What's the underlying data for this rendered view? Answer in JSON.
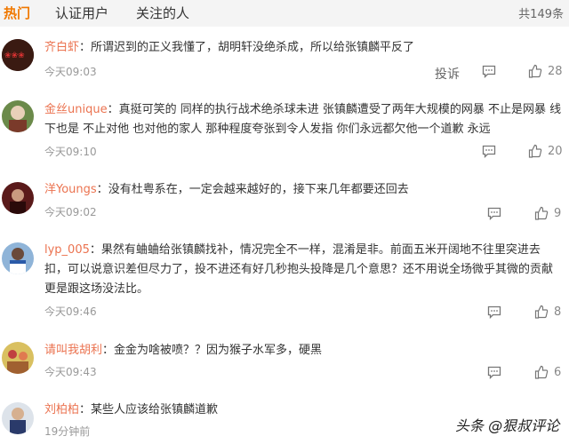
{
  "tabs": [
    {
      "label": "热门"
    },
    {
      "label": "认证用户"
    },
    {
      "label": "关注的人"
    }
  ],
  "total": "共149条",
  "report_label": "投诉",
  "comments": [
    {
      "user": "齐白虾",
      "sep": "：",
      "text": "所谓迟到的正义我懂了，胡明轩没绝杀成，所以给张镇麟平反了",
      "time": "今天09:03",
      "likes": "28"
    },
    {
      "user": "金丝unique",
      "sep": "：",
      "text": "真挺可笑的 同样的执行战术绝杀球未进 张镇麟遭受了两年大规模的网暴 不止是网暴 线下也是 不止对他 也对他的家人 那种程度夸张到令人发指 你们永远都欠他一个道歉 永远",
      "time": "今天09:10",
      "likes": "20"
    },
    {
      "user": "洋Youngs",
      "sep": "：",
      "text": "没有杜粤系在，一定会越来越好的，接下来几年都要还回去",
      "time": "今天09:02",
      "likes": "9"
    },
    {
      "user": "lyp_005",
      "sep": "：",
      "text": "果然有蛐蛐给张镇麟找补，情况完全不一样，混淆是非。前面五米开阔地不往里突进去扣，可以说意识差但尽力了，投不进还有好几秒抱头投降是几个意思？还不用说全场微乎其微的贡献更是跟这场没法比。",
      "time": "今天09:46",
      "likes": "8"
    },
    {
      "user": "请叫我胡利",
      "sep": "：",
      "text": "金金为啥被喷？？因为猴子水军多，硬黑",
      "time": "今天09:43",
      "likes": "6"
    },
    {
      "user": "刘柏柏",
      "sep": "：",
      "text": "某些人应该给张镇麟道歉",
      "time": "19分钟前",
      "likes": ""
    }
  ],
  "watermark": {
    "text": "头条 @狠叔评论"
  }
}
